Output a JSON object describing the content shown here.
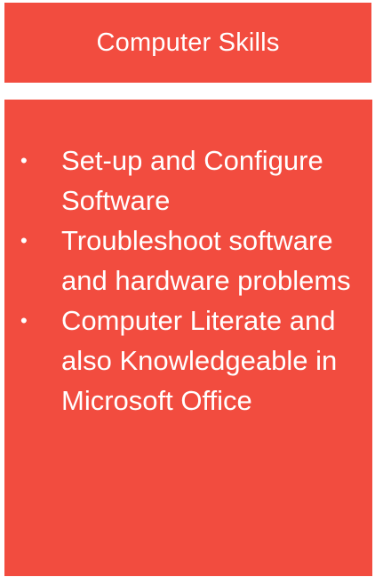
{
  "header": {
    "title": "Computer Skills"
  },
  "skills": {
    "items": [
      {
        "label": "Set-up and Configure Software"
      },
      {
        "label": "Troubleshoot software and hardware problems"
      },
      {
        "label": "Computer Literate and also Knowledgeable in Microsoft Office"
      }
    ],
    "bullet": "•"
  },
  "colors": {
    "panel": "#f24c3f",
    "text": "#ffffff"
  }
}
